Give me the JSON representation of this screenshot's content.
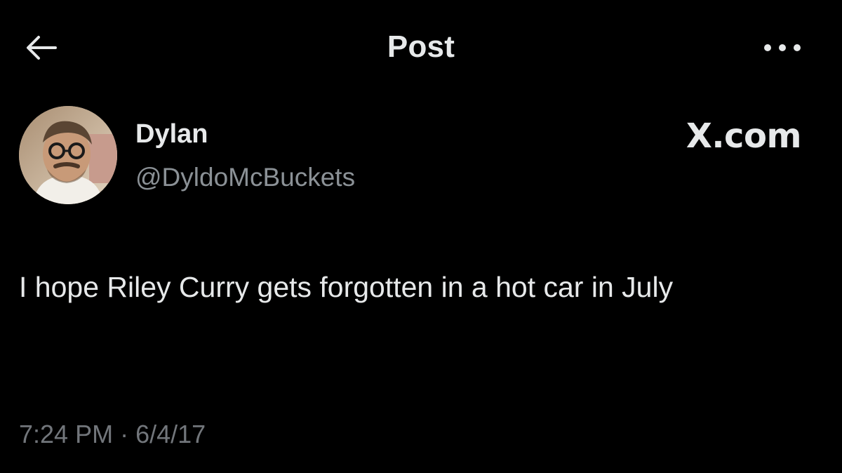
{
  "header": {
    "title": "Post",
    "back_icon": "arrow-left-icon",
    "more_icon": "more-horizontal-icon"
  },
  "author": {
    "display_name": "Dylan",
    "handle": "@DyldoMcBuckets",
    "avatar_icon": "avatar"
  },
  "source_label": "X.com",
  "post": {
    "text": "I hope Riley Curry gets forgotten in a hot car in July",
    "time": "7:24 PM",
    "separator": "·",
    "date": "6/4/17"
  },
  "colors": {
    "background": "#000000",
    "primary_text": "#e7e9ea",
    "secondary_text": "#8b9196"
  }
}
